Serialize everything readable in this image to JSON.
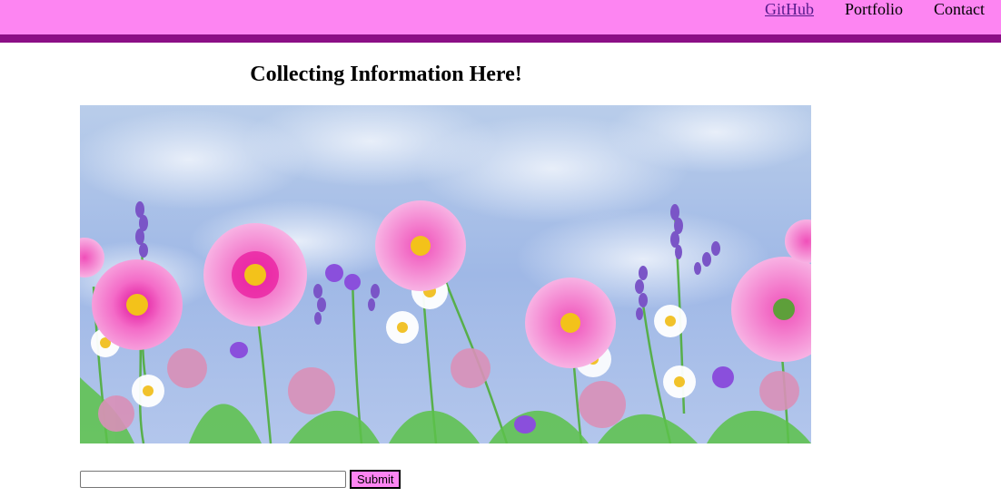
{
  "nav": {
    "github_label": "GitHub",
    "portfolio_label": "Portfolio",
    "contact_label": "Contact"
  },
  "main": {
    "title": "Collecting Information Here!"
  },
  "form": {
    "input_value": "",
    "input_placeholder": "",
    "submit_label": "Submit"
  },
  "colors": {
    "header_bg": "#fd85f2",
    "header_border": "#8b0f86",
    "link_visited": "#551a8b",
    "button_bg": "#fd85f2"
  }
}
